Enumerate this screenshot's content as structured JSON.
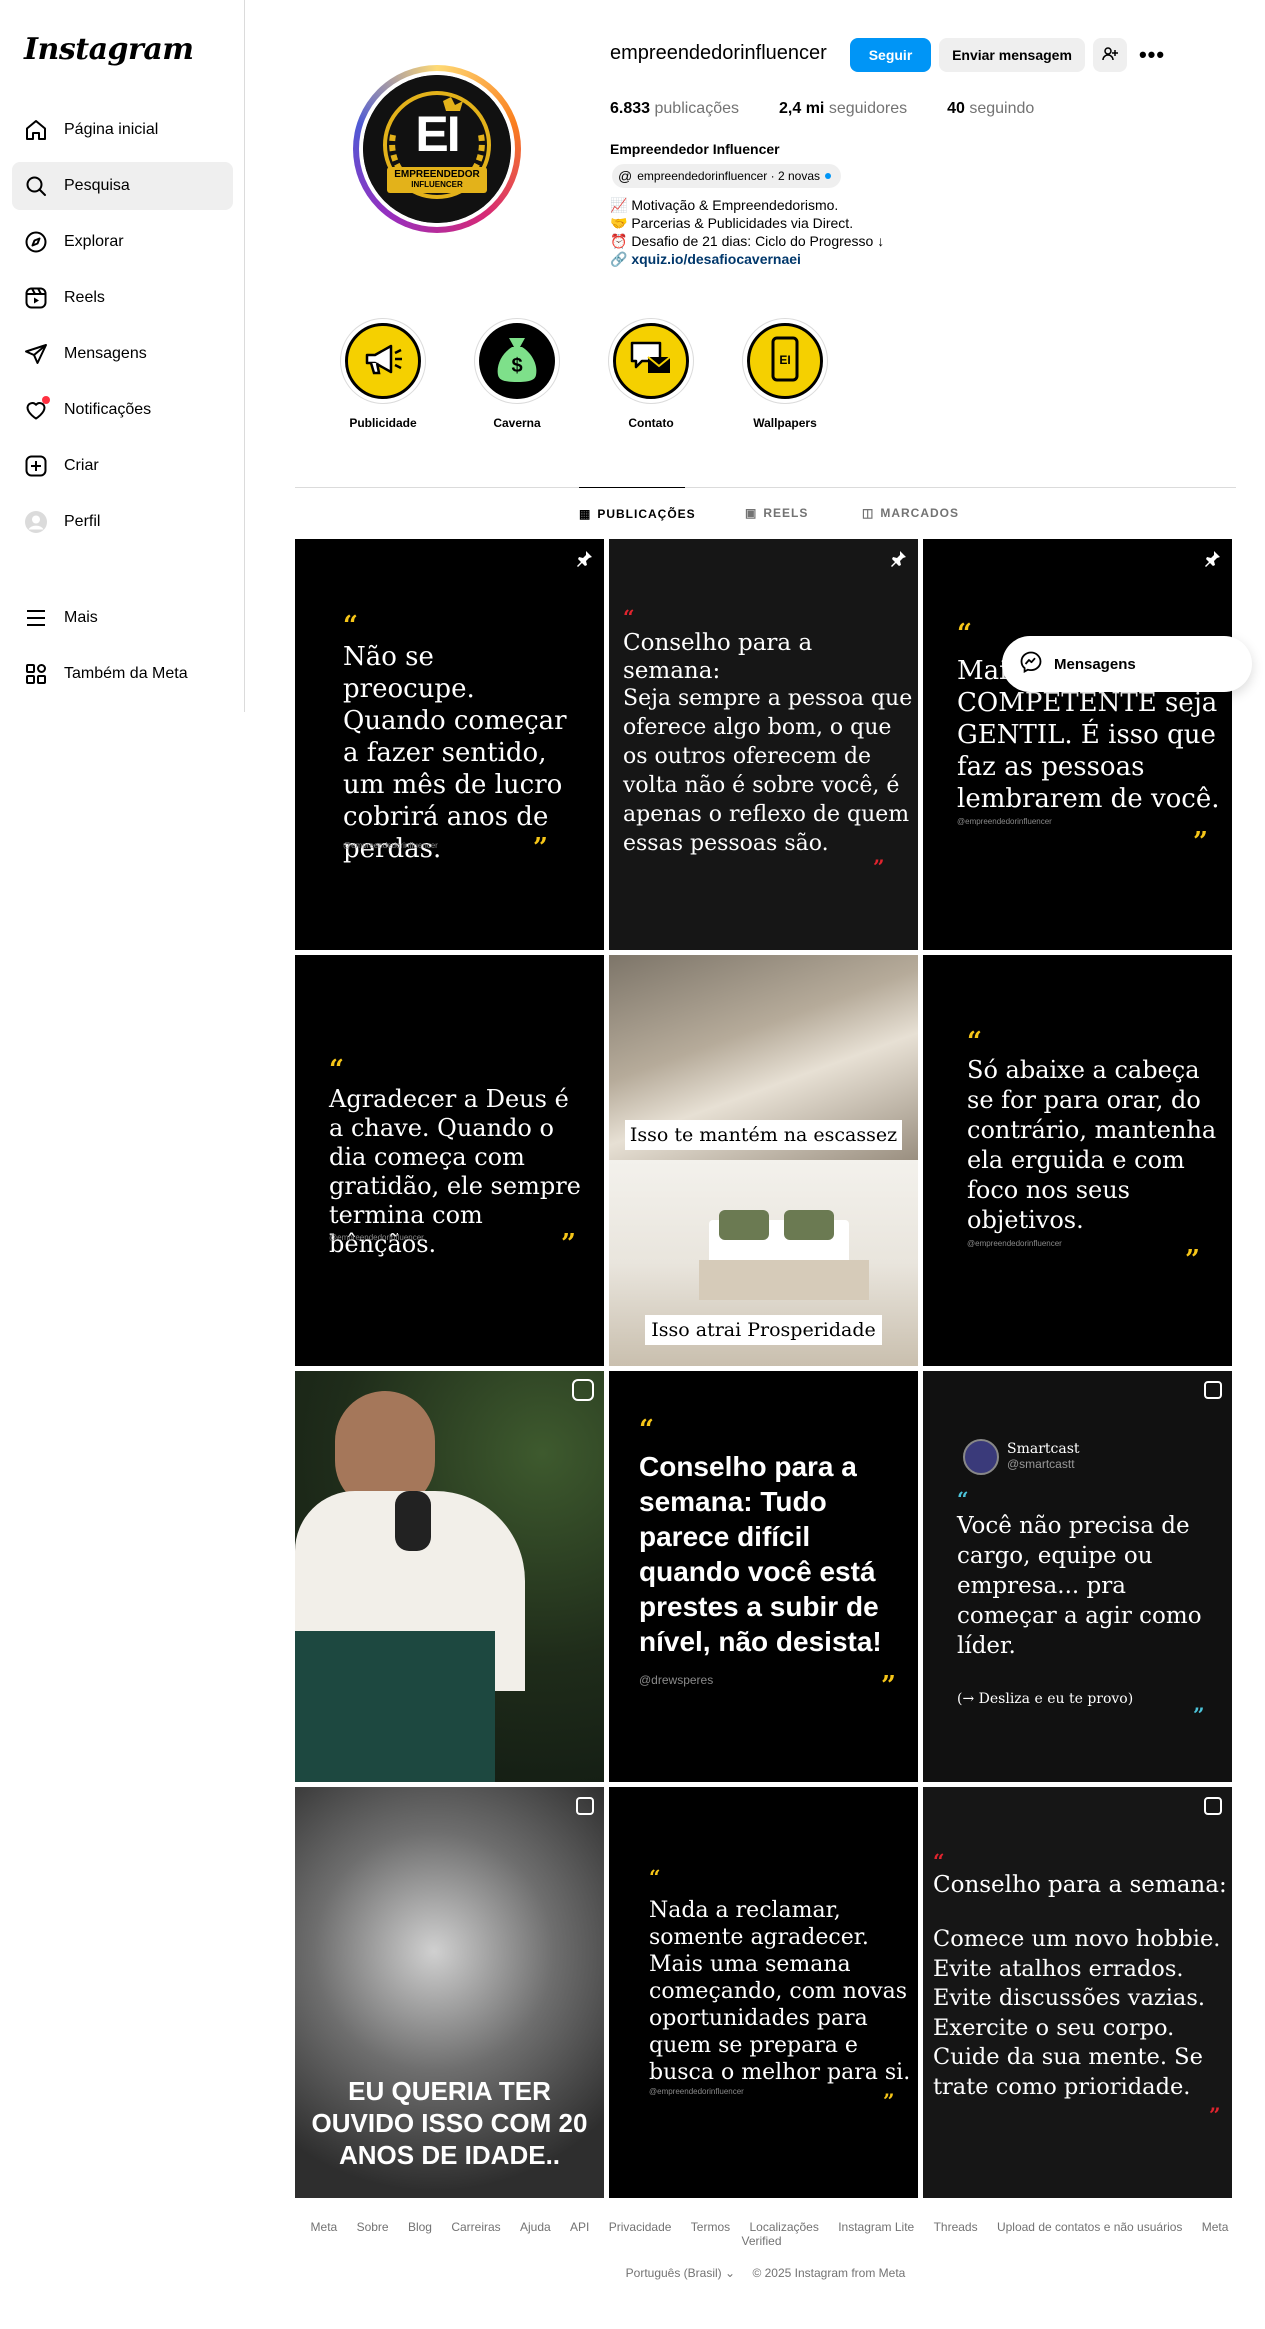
{
  "app": {
    "logo": "Instagram"
  },
  "sidebar": {
    "items": [
      {
        "label": "Página inicial",
        "icon": "home-icon"
      },
      {
        "label": "Pesquisa",
        "icon": "search-icon"
      },
      {
        "label": "Explorar",
        "icon": "compass-icon"
      },
      {
        "label": "Reels",
        "icon": "reels-icon"
      },
      {
        "label": "Mensagens",
        "icon": "send-icon"
      },
      {
        "label": "Notificações",
        "icon": "heart-icon"
      },
      {
        "label": "Criar",
        "icon": "plus-icon"
      },
      {
        "label": "Perfil",
        "icon": "avatar-icon"
      },
      {
        "label": "Mais",
        "icon": "menu-icon"
      },
      {
        "label": "Também da Meta",
        "icon": "meta-icon"
      }
    ]
  },
  "profile": {
    "username": "empreendedorinfluencer",
    "follow": "Seguir",
    "message": "Enviar mensagem",
    "posts_count": "6.833",
    "posts_label": "publicações",
    "followers_count": "2,4 mi",
    "followers_label": "seguidores",
    "following_count": "40",
    "following_label": "seguindo",
    "full_name": "Empreendedor Influencer",
    "threads": "empreendedorinfluencer · 2 novas",
    "bio": [
      "📈 Motivação & Empreendedorismo.",
      "🤝 Parcerias & Publicidades via Direct.",
      "⏰ Desafio de 21 dias: Ciclo do Progresso ↓"
    ],
    "link": "xquiz.io/desafiocavernaei",
    "avatar_text": "EI",
    "avatar_banner_1": "EMPREENDEDOR",
    "avatar_banner_2": "INFLUENCER"
  },
  "highlights": [
    {
      "label": "Publicidade"
    },
    {
      "label": "Caverna"
    },
    {
      "label": "Contato"
    },
    {
      "label": "Wallpapers"
    }
  ],
  "tabs": [
    "PUBLICAÇÕES",
    "REELS",
    "MARCADOS"
  ],
  "posts": {
    "p1": {
      "text": "Não se preocupe. Quando começar a fazer sentido, um mês de lucro cobrirá anos de perdas.",
      "handle": "@empreendedorinfluencer"
    },
    "p2": {
      "text1": "Conselho para a semana:",
      "text2": "Seja sempre a pessoa que oferece algo bom, o que os outros oferecem de volta não é sobre você, é apenas o reflexo de quem essas pessoas são."
    },
    "p3": {
      "text": "Mais COMPETENTE seja GENTIL. É isso que faz as pessoas lembrarem de você.",
      "handle": "@empreendedorinfluencer"
    },
    "p4": {
      "text": "Agradecer a Deus é a chave. Quando o dia começa com gratidão, ele sempre termina com bênçãos.",
      "handle": "@empreendedorinfluencer"
    },
    "p5": {
      "cap1": "Isso te mantém na escassez",
      "cap2": "Isso atrai Prosperidade"
    },
    "p6": {
      "text": "Só abaixe a cabeça se for para orar, do contrário, mantenha ela erguida e com foco nos seus objetivos.",
      "handle": "@empreendedorinfluencer"
    },
    "p8": {
      "text": "Conselho para a semana: Tudo parece difícil quando você está prestes a subir de nível, não desista!",
      "handle": "@drewsperes"
    },
    "p9": {
      "name": "Smartcast",
      "handle": "@smartcastt",
      "text": "Você não precisa de cargo, equipe ou empresa... pra começar a agir como líder.",
      "cta": "(→ Desliza e eu te provo)"
    },
    "p10": {
      "caption": "EU QUERIA TER OUVIDO ISSO COM 20 ANOS DE IDADE.."
    },
    "p11": {
      "text": "Nada a reclamar, somente agradecer. Mais uma semana começando, com novas oportunidades para quem se prepara e busca o melhor para si.",
      "handle": "@empreendedorinfluencer"
    },
    "p12": {
      "text1": "Conselho para a semana:",
      "text2": "Comece um novo hobbie. Evite atalhos errados. Evite discussões vazias. Exercite o seu corpo. Cuide da sua mente. Se trate como prioridade."
    }
  },
  "messages_pill": "Mensagens",
  "footer": {
    "links": [
      "Meta",
      "Sobre",
      "Blog",
      "Carreiras",
      "Ajuda",
      "API",
      "Privacidade",
      "Termos",
      "Localizações",
      "Instagram Lite",
      "Threads",
      "Upload de contatos e não usuários",
      "Meta Verified"
    ],
    "language": "Português (Brasil)",
    "copyright": "© 2025 Instagram from Meta"
  },
  "colors": {
    "accent": "#0095f6",
    "quote_yellow": "#f5c518",
    "quote_red": "#e0242e"
  }
}
